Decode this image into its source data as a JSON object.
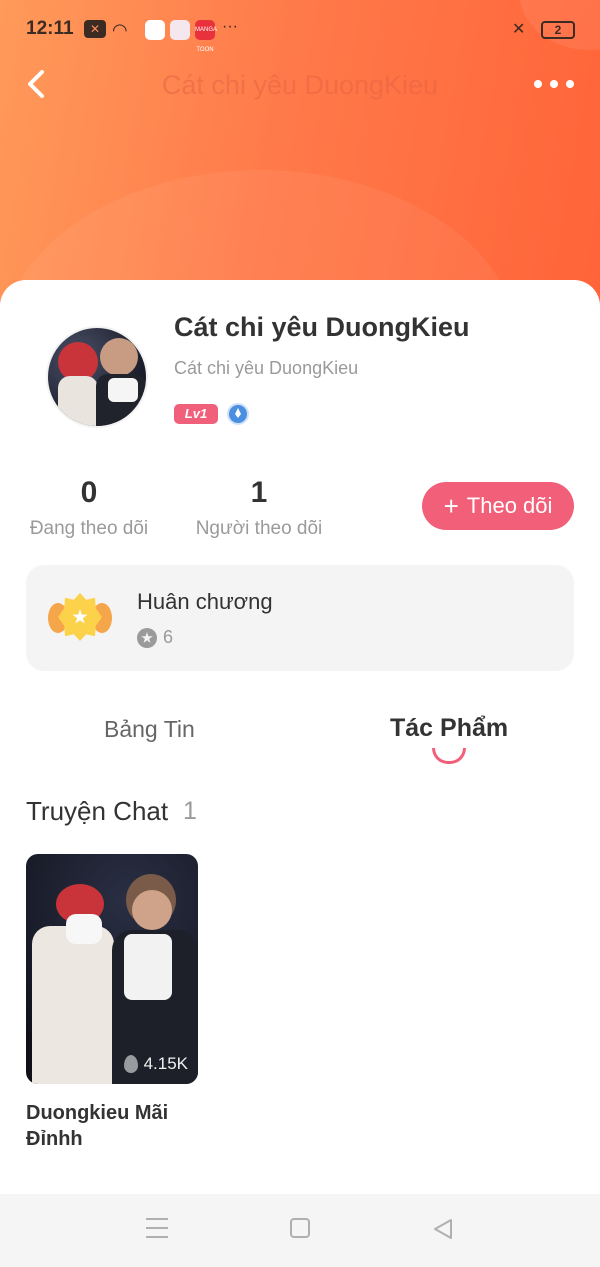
{
  "status_bar": {
    "time": "12:11",
    "icons": [
      "notification-x-icon",
      "wifi-icon",
      "app-icon",
      "app-icon",
      "app-icon",
      "more-notifications-icon",
      "vibrate-off-icon"
    ],
    "app3_text": "MANGA TOON",
    "battery": "2"
  },
  "nav": {
    "title": "Cát chi yêu DuongKieu",
    "back_icon": "chevron-left-icon",
    "more_icon": "more-horizontal-icon"
  },
  "profile": {
    "name": "Cát chi yêu DuongKieu",
    "handle": "Cát chi yêu DuongKieu",
    "level": "Lv1"
  },
  "stats": {
    "following_count": "0",
    "following_label": "Đang theo dõi",
    "followers_count": "1",
    "followers_label": "Người theo dõi"
  },
  "follow_button": {
    "plus": "+",
    "label": "Theo dõi"
  },
  "medal": {
    "title": "Huân chương",
    "count": "6"
  },
  "tabs": [
    {
      "label": "Bảng Tin",
      "active": false
    },
    {
      "label": "Tác Phẩm",
      "active": true
    }
  ],
  "section": {
    "title": "Truyện Chat",
    "count": "1"
  },
  "stories": [
    {
      "title": "Duongkieu Mãi Đỉnhh",
      "views": "4.15K"
    }
  ],
  "colors": {
    "header_gradient_start": "#ff9a5a",
    "header_gradient_end": "#ff6438",
    "accent": "#f25f78",
    "level_badge": "#f0607a",
    "gem": "#4a8fe0"
  }
}
